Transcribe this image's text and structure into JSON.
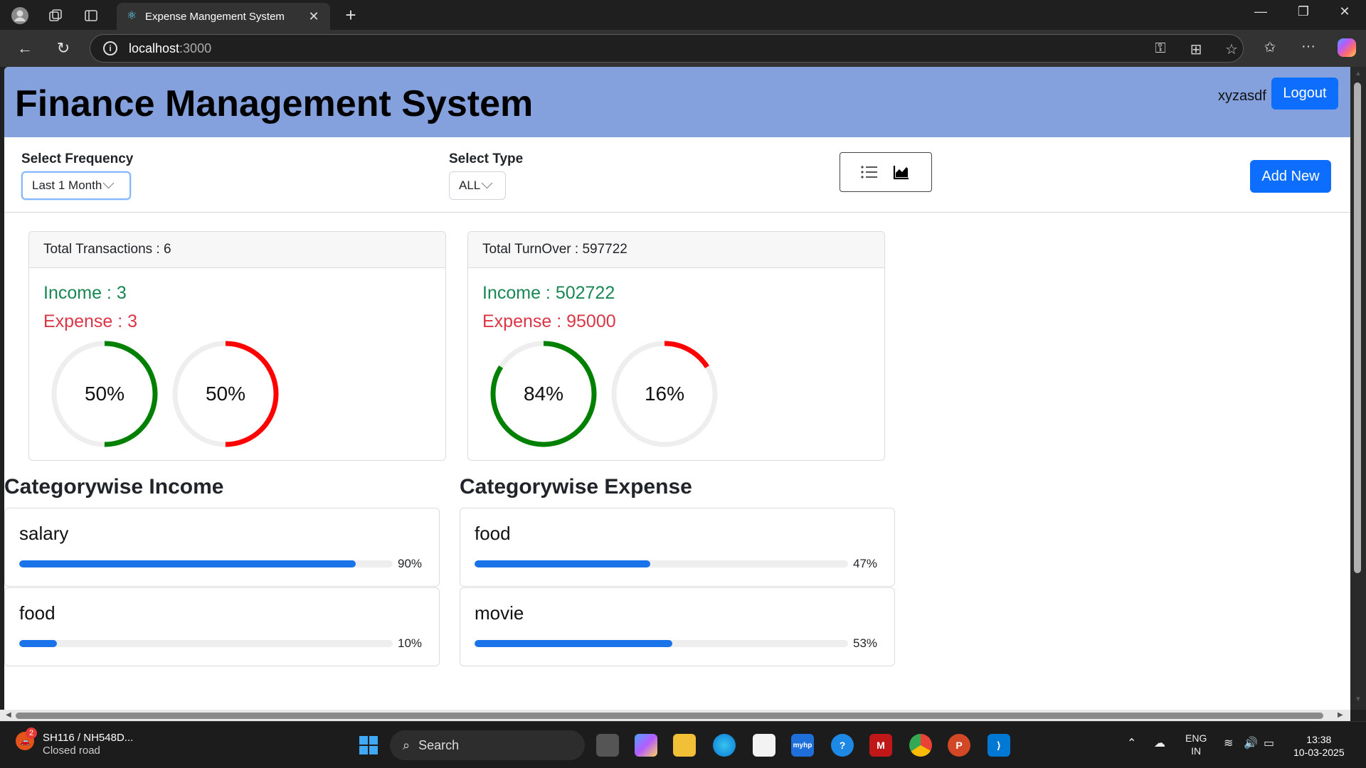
{
  "browser": {
    "tab_title": "Expense Mangement System",
    "url_host": "localhost",
    "url_port": ":3000"
  },
  "header": {
    "title": "Finance Management System",
    "username": "xyzasdf",
    "logout_label": "Logout"
  },
  "filters": {
    "frequency_label": "Select Frequency",
    "frequency_value": "Last 1 Month",
    "type_label": "Select Type",
    "type_value": "ALL",
    "add_new_label": "Add New"
  },
  "summary": {
    "transactions": {
      "header": "Total Transactions : 6",
      "income": "Income : 3",
      "expense": "Expense : 3",
      "income_pct": 50,
      "expense_pct": 50,
      "income_pct_label": "50%",
      "expense_pct_label": "50%"
    },
    "turnover": {
      "header": "Total TurnOver : 597722",
      "income": "Income : 502722",
      "expense": "Expense : 95000",
      "income_pct": 84,
      "expense_pct": 16,
      "income_pct_label": "84%",
      "expense_pct_label": "16%"
    }
  },
  "categorywise_income": {
    "title": "Categorywise Income",
    "items": [
      {
        "name": "salary",
        "pct": 90,
        "pct_label": "90%"
      },
      {
        "name": "food",
        "pct": 10,
        "pct_label": "10%"
      }
    ]
  },
  "categorywise_expense": {
    "title": "Categorywise Expense",
    "items": [
      {
        "name": "food",
        "pct": 47,
        "pct_label": "47%"
      },
      {
        "name": "movie",
        "pct": 53,
        "pct_label": "53%"
      }
    ]
  },
  "colors": {
    "header_bg": "#85a1dd",
    "primary": "#0d6efd",
    "income": "#008000",
    "expense": "#ff0000",
    "progress": "#1a73e8"
  },
  "taskbar": {
    "weather_badge": "2",
    "weather_title": "SH116 / NH548D...",
    "weather_sub": "Closed road",
    "search_label": "Search",
    "lang_top": "ENG",
    "lang_bottom": "IN",
    "time": "13:38",
    "date": "10-03-2025"
  }
}
